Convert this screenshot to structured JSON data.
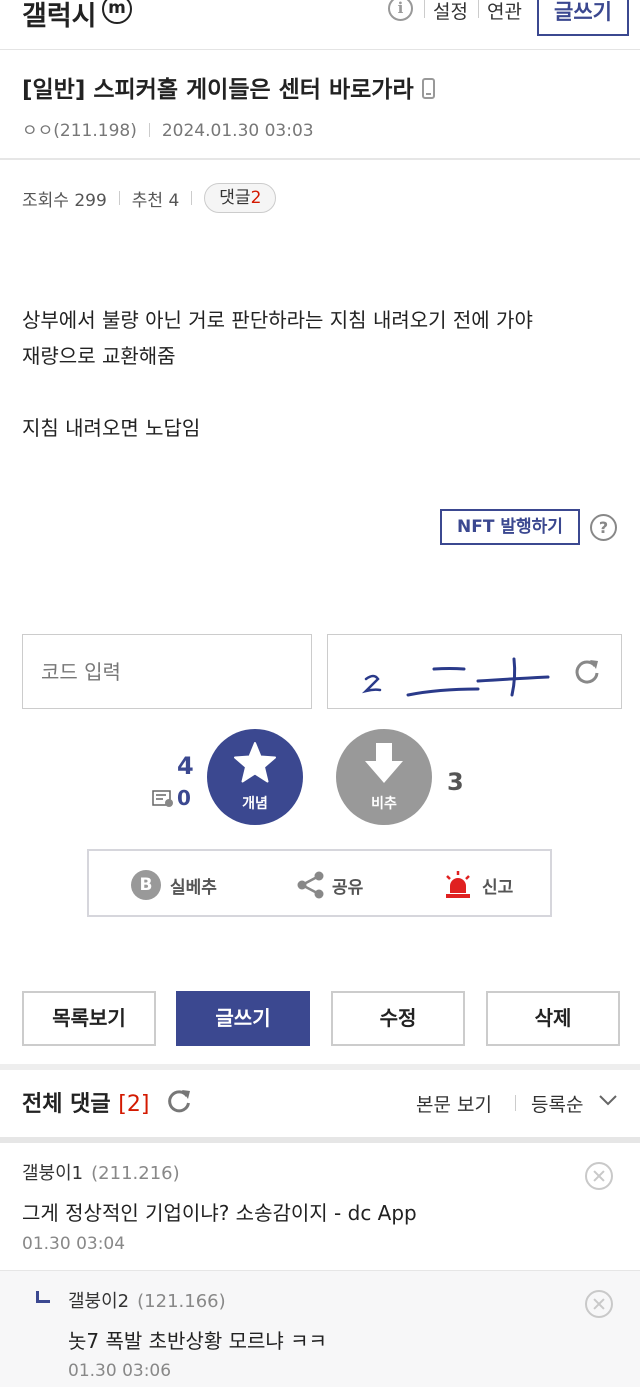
{
  "header": {
    "gallery_name": "갤럭시",
    "mini_badge": "m",
    "info_icon": "i",
    "settings_label": "설정",
    "related_label": "연관",
    "write_label": "글쓰기"
  },
  "post": {
    "title": "[일반] 스피커홀 게이들은 센터 바로가라",
    "author": "ㅇㅇ(211.198)",
    "datetime": "2024.01.30 03:03",
    "views": "조회수 299",
    "recommends": "추천 4",
    "comments_label": "댓글",
    "comments_count": "2",
    "body_lines": [
      "상부에서 불량 아닌 거로 판단하라는 지침 내려오기 전에 가야",
      "재량으로 교환해줌",
      "",
      "지침 내려오면 노답임"
    ],
    "nft_label": "NFT 발행하기",
    "help_icon": "?"
  },
  "captcha": {
    "placeholder": "코드 입력",
    "value": ""
  },
  "vote": {
    "up_count": "4",
    "fixed_count": "0",
    "up_label": "개념",
    "down_label": "비추",
    "down_count": "3"
  },
  "share": {
    "best_icon": "B",
    "best_label": "실베추",
    "share_label": "공유",
    "report_label": "신고"
  },
  "actions": {
    "list_label": "목록보기",
    "write_label": "글쓰기",
    "edit_label": "수정",
    "delete_label": "삭제"
  },
  "comments_header": {
    "title": "전체 댓글",
    "count": "[2]",
    "view_label": "본문 보기",
    "sort_label": "등록순"
  },
  "comments": [
    {
      "author": "갤붕이1",
      "ip": "(211.216)",
      "text": "그게 정상적인 기업이냐? 소송감이지 - dc App",
      "date": "01.30 03:04"
    },
    {
      "author": "갤붕이2",
      "ip": "(121.166)",
      "text": "놋7 폭발 초반상황 모르냐 ㅋㅋ",
      "date": "01.30 03:06"
    }
  ],
  "colors": {
    "brand": "#3b4890",
    "accent_red": "#d31900",
    "vote_down": "#999999",
    "report_red": "#e02020"
  }
}
